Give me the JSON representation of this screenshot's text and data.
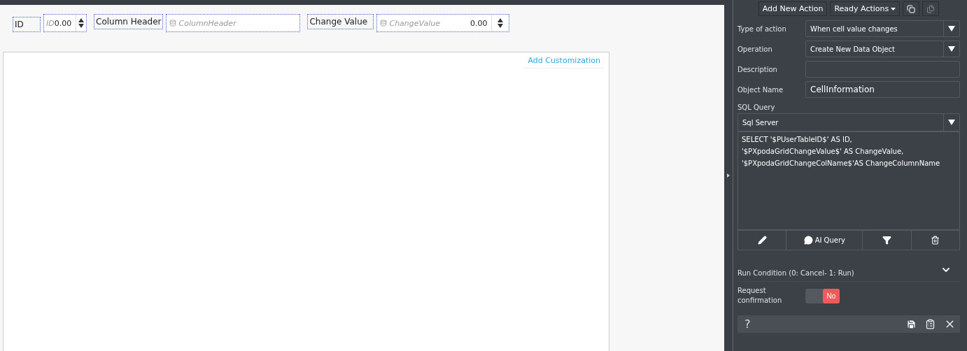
{
  "form_fields": [
    {
      "label": "ID",
      "kind": "number",
      "placeholder": "ID",
      "value": "0.00"
    },
    {
      "label": "Column Header",
      "kind": "text",
      "placeholder": "ColumnHeader"
    },
    {
      "label": "Change Value",
      "kind": "number",
      "placeholder": "ChangeValue",
      "value": "0.00"
    }
  ],
  "card": {
    "link": "Add Customization"
  },
  "panel": {
    "toolbar": [
      {
        "kind": "text",
        "label": "Add New Action",
        "disabled": false
      },
      {
        "kind": "dropdown",
        "label": "Ready Actions",
        "disabled": false
      },
      {
        "kind": "copy",
        "disabled": false
      },
      {
        "kind": "paste",
        "disabled": true
      }
    ],
    "fields": [
      {
        "label": "Type of action",
        "kind": "select",
        "value": "When cell value changes"
      },
      {
        "label": "Operation",
        "kind": "select",
        "value": "Create New Data Object"
      },
      {
        "label": "Description",
        "kind": "text"
      },
      {
        "label": "Object Name",
        "kind": "text",
        "value": "CellInformation"
      }
    ],
    "sql": {
      "label": "SQL Query",
      "dialect": "Sql Server",
      "query": "SELECT '$PUserTableID$' AS ID,\n'$PXpodaGridChangeValue$' AS ChangeValue,\n'$PXpodaGridChangeColName$'AS ChangeColumnName",
      "actions": [
        {
          "kind": "edit"
        },
        {
          "kind": "ai",
          "label": "AI Query"
        },
        {
          "kind": "filter"
        },
        {
          "kind": "delete"
        }
      ]
    },
    "run_condition": {
      "label": "Run Condition (0: Cancel- 1: Run)",
      "expanded": false
    },
    "request_confirmation": {
      "label": "Request confirmation",
      "on": false,
      "text": "No"
    },
    "footer": {
      "help": "?"
    }
  }
}
